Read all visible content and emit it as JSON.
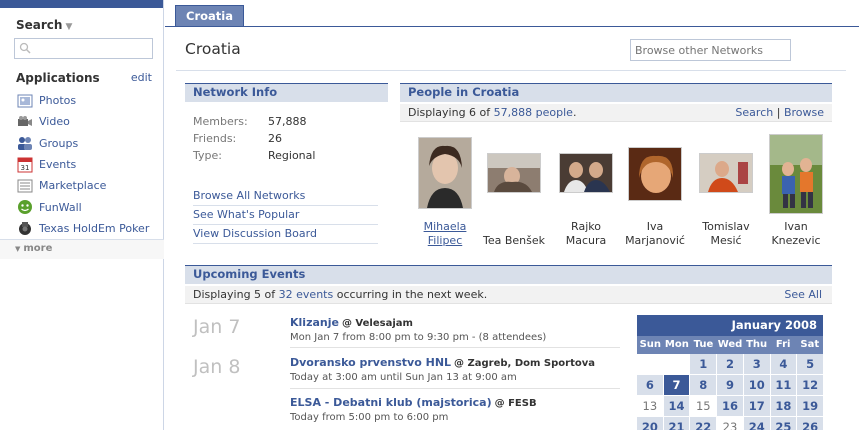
{
  "sidebar": {
    "search_label": "Search",
    "search_placeholder": "",
    "apps_label": "Applications",
    "edit_label": "edit",
    "items": [
      {
        "label": "Photos",
        "icon": "photos-icon"
      },
      {
        "label": "Video",
        "icon": "video-camera-icon"
      },
      {
        "label": "Groups",
        "icon": "groups-icon"
      },
      {
        "label": "Events",
        "icon": "calendar-icon"
      },
      {
        "label": "Marketplace",
        "icon": "marketplace-icon"
      },
      {
        "label": "FunWall",
        "icon": "funwall-icon"
      },
      {
        "label": "Texas HoldEm Poker",
        "icon": "poker-icon"
      }
    ],
    "more_label": "more"
  },
  "tab": {
    "label": "Croatia"
  },
  "page_title": "Croatia",
  "browse_networks_placeholder": "Browse other Networks",
  "network_info": {
    "heading": "Network Info",
    "rows": [
      {
        "label": "Members:",
        "value": "57,888"
      },
      {
        "label": "Friends:",
        "value": "26"
      },
      {
        "label": "Type:",
        "value": "Regional"
      }
    ],
    "links": [
      "Browse All Networks",
      "See What's Popular",
      "View Discussion Board"
    ]
  },
  "people": {
    "heading": "People in Croatia",
    "displaying_prefix": "Displaying 6 of ",
    "displaying_count": "57,888 people",
    "displaying_suffix": ".",
    "search_link": "Search",
    "separator": "|",
    "browse_link": "Browse",
    "persons": [
      {
        "line1": "Mihaela",
        "line2": "Filipec"
      },
      {
        "line1": "Tea Benšek",
        "line2": ""
      },
      {
        "line1": "Rajko",
        "line2": "Macura"
      },
      {
        "line1": "Iva",
        "line2": "Marjanović"
      },
      {
        "line1": "Tomislav",
        "line2": "Mesić"
      },
      {
        "line1": "Ivan",
        "line2": "Knezevic"
      }
    ]
  },
  "events": {
    "heading": "Upcoming Events",
    "displaying_prefix": "Displaying 5 of ",
    "displaying_count": "32 events",
    "displaying_suffix": " occurring in the next week.",
    "see_all": "See All",
    "dates": [
      "Jan 7",
      "Jan 8"
    ],
    "items": [
      {
        "title": "Klizanje",
        "location": "@ Velesajam",
        "details": "Mon Jan 7 from 8:00 pm to 9:30 pm - (8 attendees)"
      },
      {
        "title": "Dvoransko prvenstvo HNL",
        "location": "@ Zagreb, Dom Sportova",
        "details": "Today at 3:00 am until Sun Jan 13 at 9:00 am"
      },
      {
        "title": "ELSA - Debatni klub (majstorica)",
        "location": "@ FESB",
        "details": "Today from 5:00 pm to 6:00 pm"
      }
    ]
  },
  "calendar": {
    "title": "January 2008",
    "weekdays": [
      "Sun",
      "Mon",
      "Tue",
      "Wed",
      "Thu",
      "Fri",
      "Sat"
    ],
    "today": "7",
    "weeks": [
      [
        "",
        "",
        "1",
        "2",
        "3",
        "4",
        "5"
      ],
      [
        "6",
        "7",
        "8",
        "9",
        "10",
        "11",
        "12"
      ],
      [
        "13",
        "14",
        "15",
        "16",
        "17",
        "18",
        "19"
      ],
      [
        "20",
        "21",
        "22",
        "23",
        "24",
        "25",
        "26"
      ]
    ],
    "plain_days": [
      "13",
      "15",
      "23"
    ]
  },
  "colors": {
    "brand": "#3b5998",
    "header_bg": "#d8dfea",
    "calendar_day": "#d8dfea"
  }
}
